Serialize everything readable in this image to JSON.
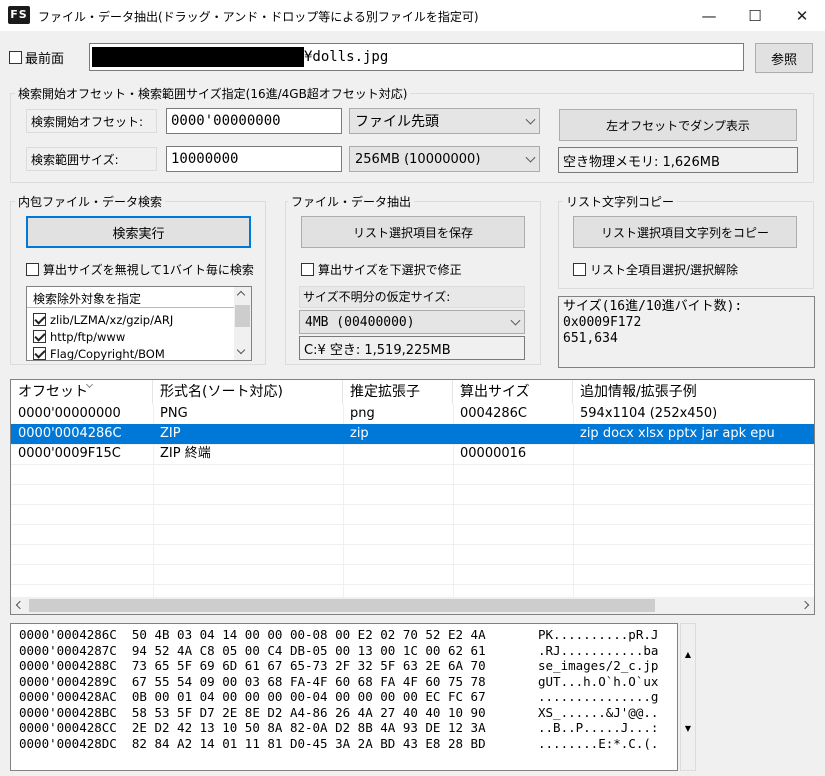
{
  "window": {
    "icon_text": "FS",
    "title": "ファイル・データ抽出(ドラッグ・アンド・ドロップ等による別ファイルを指定可)",
    "minimize_glyph": "—",
    "maximize_glyph": "☐",
    "close_glyph": "✕"
  },
  "top": {
    "topmost_label": "最前面",
    "path_value": "¥dolls.jpg",
    "browse_label": "参照"
  },
  "search_range": {
    "group_title": "検索開始オフセット・検索範囲サイズ指定(16進/4GB超オフセット対応)",
    "start_offset_label": "検索開始オフセット:",
    "start_offset_value": "0000'00000000",
    "start_mode_value": "ファイル先頭",
    "dump_left_label": "左オフセットでダンプ表示",
    "range_size_label": "検索範囲サイズ:",
    "range_size_value": "10000000",
    "range_preset_value": "256MB (10000000)",
    "free_memory_text": "空き物理メモリ: 1,626MB"
  },
  "inner_search": {
    "group_title": "内包ファイル・データ検索",
    "run_label": "検索実行",
    "ignore_size_label": "算出サイズを無視して1バイト毎に検索",
    "exclude_title": "検索除外対象を指定",
    "exclude_items": [
      {
        "label": "zlib/LZMA/xz/gzip/ARJ"
      },
      {
        "label": "http/ftp/www"
      },
      {
        "label": "Flag/Copyright/BOM"
      }
    ]
  },
  "extract": {
    "group_title": "ファイル・データ抽出",
    "save_label": "リスト選択項目を保存",
    "fix_size_label": "算出サイズを下選択で修正",
    "unknown_size_title": "サイズ不明分の仮定サイズ:",
    "unknown_size_value": "4MB   (00400000)",
    "disk_free_text": "C:¥  空き: 1,519,225MB"
  },
  "list_copy": {
    "group_title": "リスト文字列コピー",
    "copy_label": "リスト選択項目文字列をコピー",
    "toggle_all_label": "リスト全項目選択/選択解除",
    "size_info_lines": [
      "サイズ(16進/10進バイト数):",
      "0x0009F172",
      "651,634"
    ]
  },
  "results": {
    "columns": [
      "オフセット",
      "形式名(ソート対応)",
      "推定拡張子",
      "算出サイズ",
      "追加情報/拡張子例"
    ],
    "rows": [
      {
        "offset": "0000'00000000",
        "format": "PNG",
        "ext": "png",
        "size": "0004286C",
        "info": "594x1104 (252x450)"
      },
      {
        "offset": "0000'0004286C",
        "format": "ZIP",
        "ext": "zip",
        "size": "",
        "info": "zip docx xlsx pptx jar apk epu"
      },
      {
        "offset": "0000'0009F15C",
        "format": "ZIP 終端",
        "ext": "",
        "size": "00000016",
        "info": ""
      }
    ],
    "selected_row_index": 1
  },
  "hexdump": {
    "lines": [
      {
        "offset": "0000'0004286C",
        "hex": "50 4B 03 04 14 00 00 00-08 00 E2 02 70 52 E2 4A",
        "ascii": "PK..........pR.J"
      },
      {
        "offset": "0000'0004287C",
        "hex": "94 52 4A C8 05 00 C4 DB-05 00 13 00 1C 00 62 61",
        "ascii": ".RJ...........ba"
      },
      {
        "offset": "0000'0004288C",
        "hex": "73 65 5F 69 6D 61 67 65-73 2F 32 5F 63 2E 6A 70",
        "ascii": "se_images/2_c.jp"
      },
      {
        "offset": "0000'0004289C",
        "hex": "67 55 54 09 00 03 68 FA-4F 60 68 FA 4F 60 75 78",
        "ascii": "gUT...h.O`h.O`ux"
      },
      {
        "offset": "0000'000428AC",
        "hex": "0B 00 01 04 00 00 00 00-04 00 00 00 00 EC FC 67",
        "ascii": "...............g"
      },
      {
        "offset": "0000'000428BC",
        "hex": "58 53 5F D7 2E 8E D2 A4-86 26 4A 27 40 40 10 90",
        "ascii": "XS_......&J'@@.."
      },
      {
        "offset": "0000'000428CC",
        "hex": "2E D2 42 13 10 50 8A 82-0A D2 8B 4A 93 DE 12 3A",
        "ascii": "..B..P.....J...:"
      },
      {
        "offset": "0000'000428DC",
        "hex": "82 84 A2 14 01 11 81 D0-45 3A 2A BD 43 E8 28 BD",
        "ascii": "........E:*.C.(."
      }
    ],
    "scroll_up_glyph": "▲",
    "scroll_down_glyph": "▼"
  },
  "colors": {
    "selection": "#0078d7",
    "focus_border": "#0078d7",
    "redaction": "#000000"
  }
}
